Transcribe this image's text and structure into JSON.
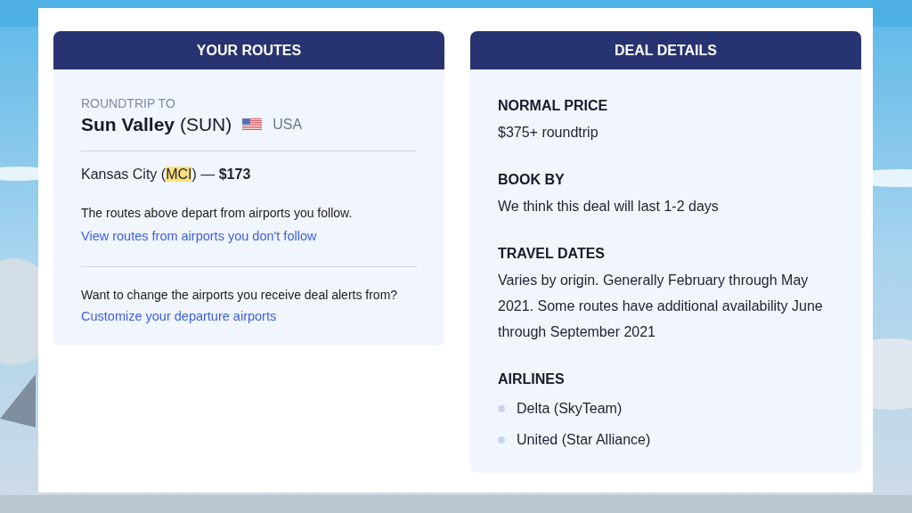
{
  "routes_card": {
    "title": "YOUR ROUTES",
    "eyebrow": "ROUNDTRIP TO",
    "destination": "**Sun Valley** (SUN)",
    "country": "USA",
    "route": {
      "before": "Kansas City (",
      "code": "MCI",
      "after": ") — **$173**"
    },
    "note": "The routes above depart from airports you follow.",
    "note_link": "View routes from airports you don't follow",
    "change_text": "Want to change the airports you receive deal alerts from?",
    "change_link": "Customize your departure airports"
  },
  "deal_card": {
    "title": "DEAL DETAILS",
    "sections": [
      {
        "kind": "text",
        "heading": "NORMAL PRICE",
        "body": "$375+ roundtrip"
      },
      {
        "kind": "text",
        "heading": "BOOK BY",
        "body": "We think this deal will last 1-2 days"
      },
      {
        "kind": "text",
        "heading": "TRAVEL DATES",
        "body": "Varies by origin. Generally February through May 2021. Some routes have additional availability June through September 2021"
      },
      {
        "kind": "list",
        "heading": "AIRLINES",
        "items": [
          "Delta (SkyTeam)",
          "United (Star Alliance)"
        ]
      }
    ]
  }
}
